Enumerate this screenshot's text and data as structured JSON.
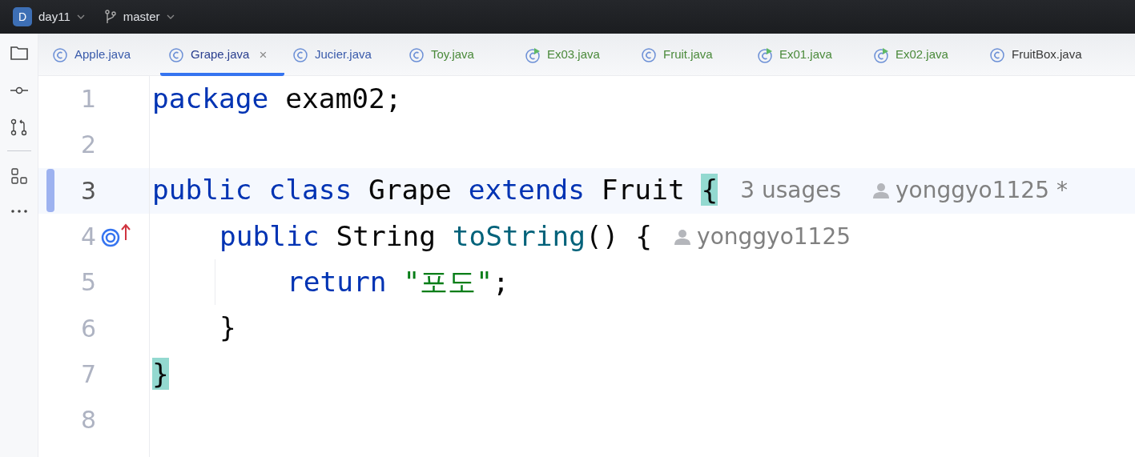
{
  "title_bar": {
    "project": {
      "badge": "D",
      "name": "day11"
    },
    "branch": "master"
  },
  "tabs": [
    {
      "label": "Apple.java",
      "kind": "class",
      "color": "#3a5bab",
      "selected": false
    },
    {
      "label": "Grape.java",
      "kind": "class",
      "color": "#2a3f8f",
      "selected": true,
      "close": "×"
    },
    {
      "label": "Jucier.java",
      "kind": "class",
      "color": "#3a5bab",
      "selected": false
    },
    {
      "label": "Toy.java",
      "kind": "class",
      "color": "#4b8a3b",
      "selected": false
    },
    {
      "label": "Ex03.java",
      "kind": "runnable",
      "color": "#4b8a3b",
      "selected": false
    },
    {
      "label": "Fruit.java",
      "kind": "class",
      "color": "#4b8a3b",
      "selected": false
    },
    {
      "label": "Ex01.java",
      "kind": "runnable",
      "color": "#4b8a3b",
      "selected": false
    },
    {
      "label": "Ex02.java",
      "kind": "runnable",
      "color": "#4b8a3b",
      "selected": false
    },
    {
      "label": "FruitBox.java",
      "kind": "class",
      "color": "#383838",
      "selected": false
    }
  ],
  "editor": {
    "lines": [
      {
        "number": "1",
        "current": false,
        "tokens": [
          {
            "kind": "keyword",
            "text": "package"
          },
          {
            "kind": "plain",
            "text": " exam02;"
          }
        ]
      },
      {
        "number": "2",
        "current": false
      },
      {
        "number": "3",
        "current": true,
        "changed": true,
        "tokens": [
          {
            "kind": "keyword",
            "text": "public class"
          },
          {
            "kind": "plain",
            "text": " Grape "
          },
          {
            "kind": "keyword",
            "text": "extends"
          },
          {
            "kind": "plain",
            "text": " Fruit "
          },
          {
            "kind": "brace_match",
            "text": "{"
          }
        ],
        "hints": [
          {
            "kind": "usages",
            "text": "3 usages"
          },
          {
            "kind": "author",
            "text": "yonggyo1125 *"
          }
        ],
        "children": [
          {
            "number": "4",
            "current": false,
            "overrides": true,
            "tokens": [
              {
                "kind": "keyword",
                "text": "public"
              },
              {
                "kind": "plain",
                "text": " String "
              },
              {
                "kind": "method",
                "text": "toString"
              },
              {
                "kind": "plain",
                "text": "() {"
              }
            ],
            "hints": [
              {
                "kind": "author",
                "text": "yonggyo1125"
              }
            ],
            "children": [
              {
                "number": "5",
                "current": false,
                "tokens": [
                  {
                    "kind": "keyword",
                    "text": "return"
                  },
                  {
                    "kind": "string",
                    "text": " \"포도\""
                  },
                  {
                    "kind": "plain",
                    "text": ";"
                  }
                ]
              }
            ]
          },
          {
            "number": "6",
            "current": false,
            "tokens": [
              {
                "kind": "plain",
                "text": "}"
              }
            ]
          }
        ]
      },
      {
        "number": "7",
        "current": false,
        "tokens": [
          {
            "kind": "brace_match",
            "text": "}"
          }
        ]
      },
      {
        "number": "8",
        "current": false
      }
    ]
  }
}
